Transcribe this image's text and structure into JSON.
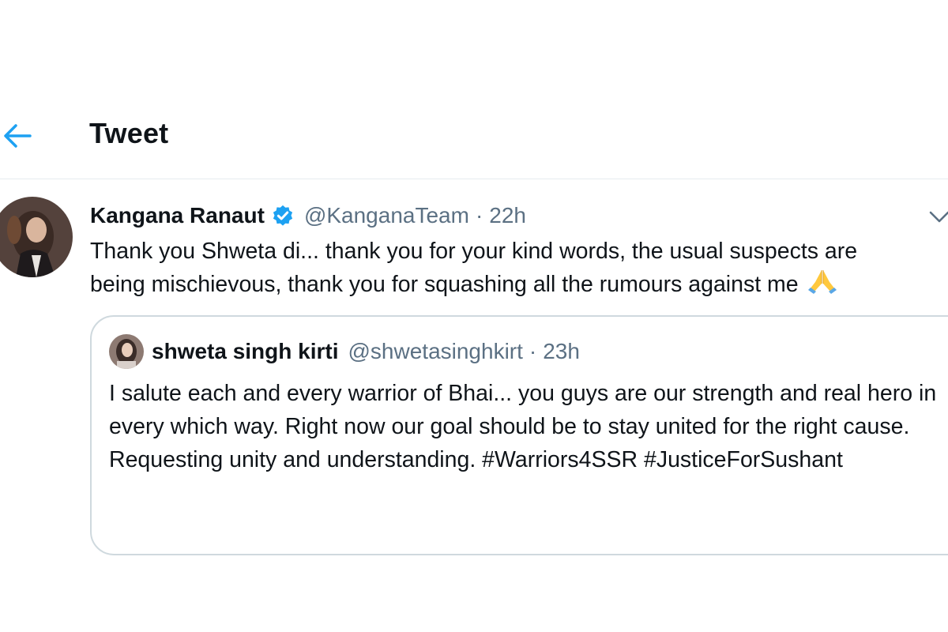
{
  "header": {
    "title": "Tweet",
    "back_icon": "arrow-left-icon",
    "accent_color": "#1da1f2"
  },
  "tweet": {
    "author_name": "Kangana Ranaut",
    "verified_icon": "verified-badge-icon",
    "handle": "@KanganaTeam",
    "separator": "·",
    "time": "22h",
    "more_icon": "chevron-down-icon",
    "text_line1": "Thank you Shweta di... thank you for your kind words, the usual suspects are",
    "text_line2": "being mischievous, thank you for squashing all the rumours against me",
    "emoji_icon": "folded-hands-icon",
    "quote": {
      "author_name": "shweta singh kirti",
      "handle": "@shwetasinghkirt",
      "separator": "·",
      "time": "23h",
      "text": "I salute each and every warrior of Bhai... you guys are our strength and real hero in every which way. Right now our goal should be to stay united for the right cause. Requesting unity and understanding. #Warriors4SSR #JusticeForSushant"
    }
  }
}
